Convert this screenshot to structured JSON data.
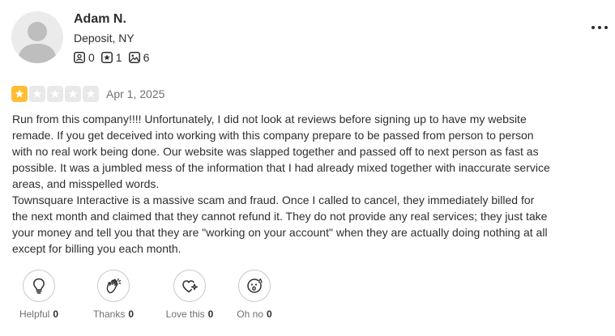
{
  "reviewer": {
    "name": "Adam N.",
    "location": "Deposit, NY",
    "stats": {
      "friends": "0",
      "reviews": "1",
      "photos": "6"
    }
  },
  "review": {
    "rating": 1,
    "rating_max": 5,
    "date": "Apr 1, 2025",
    "paragraphs": [
      "Run from this company!!!! Unfortunately, I did not look at reviews before signing up to have my website remade. If you get deceived into working with this company prepare to be passed from person to person with no real work being done. Our website was slapped together and passed off to next person as fast as possible. It was a jumbled mess of the information that I had already mixed together with inaccurate service areas, and misspelled words.",
      "Townsquare Interactive is a massive scam and fraud. Once I called to cancel, they immediately billed for the next month and claimed that they cannot refund it. They do not provide any real services; they just take your money and tell you that they are \"working on your account\" when they are actually doing nothing at all except for billing you each month."
    ]
  },
  "reactions": [
    {
      "icon": "lightbulb-icon",
      "label": "Helpful",
      "count": "0"
    },
    {
      "icon": "clapping-hands-icon",
      "label": "Thanks",
      "count": "0"
    },
    {
      "icon": "heart-sparkle-icon",
      "label": "Love this",
      "count": "0"
    },
    {
      "icon": "surprised-face-icon",
      "label": "Oh no",
      "count": "0"
    }
  ],
  "colors": {
    "star_filled": "#ffbe33",
    "star_empty": "#e9e9e9",
    "text": "#2d2e2f",
    "muted": "#6e7072"
  }
}
